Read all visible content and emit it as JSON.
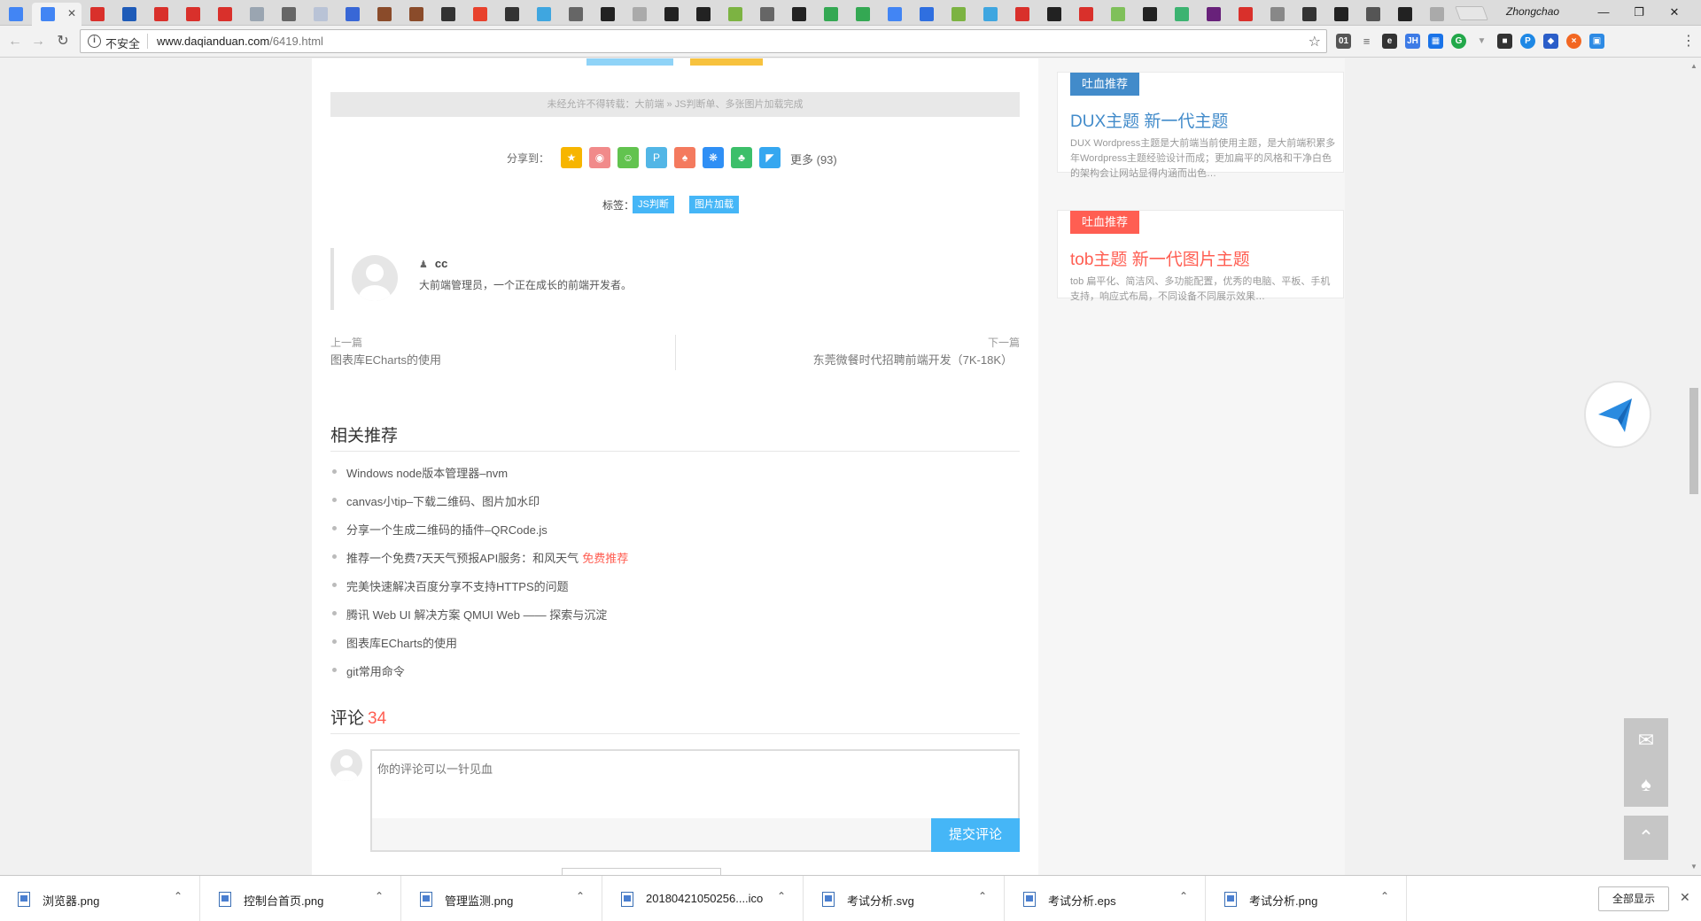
{
  "browser": {
    "profile_name": "Zhongchao",
    "security_label": "不安全",
    "url_host": "www.daqianduan.com",
    "url_path": "/6419.html",
    "tab_icons": [
      "google-icon",
      "google-icon",
      "csdn-icon",
      "5-icon",
      "csdn-icon",
      "csdn-icon",
      "csdn-icon",
      "page-icon",
      "link-icon",
      "star-icon",
      "editor-icon",
      "photo-icon",
      "photo-icon",
      "person-icon",
      "plus-icon",
      "code-icon",
      "cloud-icon",
      "link-icon",
      "github-icon",
      "file-icon",
      "github-icon",
      "arrow-icon",
      "microsoft-icon",
      "link-icon",
      "github-icon",
      "play-icon",
      "play-icon",
      "google-icon",
      "baidu-icon",
      "microsoft-icon",
      "cloud-icon",
      "csdn-icon",
      "github-icon",
      "csdn-icon",
      "chat-icon",
      "github-icon",
      "android-icon",
      "vs-icon",
      "csdn-icon",
      "tab-icon",
      "bt-icon",
      "github-icon",
      "download-icon",
      "terminal-icon",
      "file-icon"
    ]
  },
  "article": {
    "copyright": "未经允许不得转载：大前端 » JS判断单、多张图片加载完成",
    "share_label": "分享到：",
    "share_more": "更多 (93)",
    "tags_label": "标签：",
    "tags": [
      "JS判断",
      "图片加载"
    ],
    "author_name": "cc",
    "author_bio": "大前端管理员，一个正在成长的前端开发者。",
    "prev_label": "上一篇",
    "prev_title": "图表库ECharts的使用",
    "next_label": "下一篇",
    "next_title": "东莞微餐时代招聘前端开发（7K-18K）",
    "related_title": "相关推荐",
    "related": [
      {
        "text": "Windows node版本管理器–nvm",
        "hot": ""
      },
      {
        "text": "canvas小tip–下载二维码、图片加水印",
        "hot": ""
      },
      {
        "text": "分享一个生成二维码的插件–QRCode.js",
        "hot": ""
      },
      {
        "text": "推荐一个免费7天天气预报API服务：和风天气",
        "hot": "免费推荐"
      },
      {
        "text": "完美快速解决百度分享不支持HTTPS的问题",
        "hot": ""
      },
      {
        "text": "腾讯 Web UI 解决方案 QMUI Web —— 探索与沉淀",
        "hot": ""
      },
      {
        "text": "图表库ECharts的使用",
        "hot": ""
      },
      {
        "text": "git常用命令",
        "hot": ""
      }
    ],
    "comments_label": "评论",
    "comments_count": "34",
    "comment_placeholder": "你的评论可以一针见血",
    "submit_label": "提交评论"
  },
  "sidebar": {
    "cards": [
      {
        "badge": "吐血推荐",
        "badge_color": "#428bca",
        "title": "DUX主题 新一代主题",
        "title_color": "#428bca",
        "desc": "DUX Wordpress主题是大前端当前使用主题，是大前端积累多年Wordpress主题经验设计而成；更加扁平的风格和干净白色的架构会让网站显得内涵而出色…"
      },
      {
        "badge": "吐血推荐",
        "badge_color": "#ff5e52",
        "title": "tob主题 新一代图片主题",
        "title_color": "#ff5e52",
        "desc": "tob 扁平化、简洁风、多功能配置，优秀的电脑、平板、手机支持，响应式布局，不同设备不同展示效果…"
      }
    ]
  },
  "downloads": {
    "items": [
      "浏览器.png",
      "控制台首页.png",
      "管理监测.png",
      "20180421050256....ico",
      "考试分析.svg",
      "考试分析.eps",
      "考试分析.png"
    ],
    "show_all": "全部显示"
  },
  "colors": {
    "accent": "#45b6f7",
    "red": "#ff5e52",
    "blue": "#428bca"
  }
}
